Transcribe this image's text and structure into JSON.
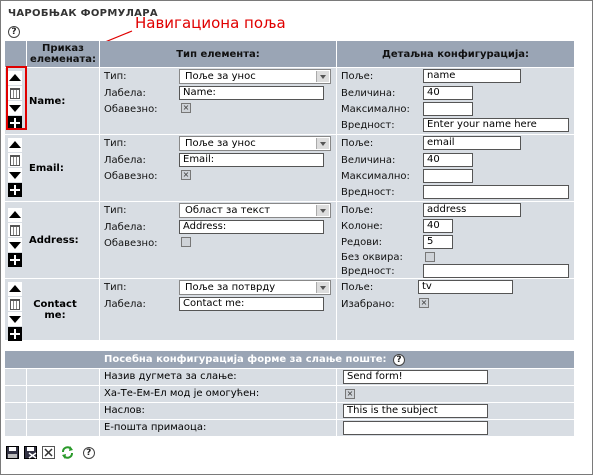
{
  "wizard_title": "ЧАРОБЊАК ФОРМУЛАРА",
  "annotation": "Навигациона поља",
  "headers": {
    "preview": "Приказ елемената:",
    "type": "Тип елемента:",
    "detail": "Детаљна конфигурација:"
  },
  "labels": {
    "type": "Тип:",
    "label": "Лабела:",
    "required": "Обавезно:",
    "field": "Поље:",
    "size": "Величина:",
    "max": "Максимално:",
    "value": "Вредност:",
    "columns": "Колоне:",
    "rows": "Редови:",
    "no_frame": "Без оквира:",
    "selected": "Изабрано:"
  },
  "elements": [
    {
      "name": "Name:",
      "type": "Поље за унос",
      "label": "Name:",
      "field": "name",
      "size": "40",
      "max": "",
      "value": "Enter your name here"
    },
    {
      "name": "Email:",
      "type": "Поље за унос",
      "label": "Email:",
      "field": "email",
      "size": "40",
      "max": "",
      "value": ""
    },
    {
      "name": "Address:",
      "type": "Област за текст",
      "label": "Address:",
      "field": "address",
      "columns": "40",
      "rows": "5",
      "value": ""
    },
    {
      "name": "Contact me:",
      "type": "Поље за потврду",
      "label": "Contact me:",
      "field": "tv"
    }
  ],
  "email_config": {
    "title": "Посебна конфигурација форме за слање поште:",
    "rows": [
      {
        "label": "Назив дугмета за слање:",
        "value": "Send form!"
      },
      {
        "label": "Ха-Те-Ем-Ел мод је омогућен:",
        "value": ""
      },
      {
        "label": "Наслов:",
        "value": "This is the subject"
      },
      {
        "label": "Е-пошта примаоца:",
        "value": ""
      }
    ]
  },
  "icons": [
    "help-icon",
    "move-up-icon",
    "delete-icon",
    "move-down-icon",
    "add-icon",
    "save-icon",
    "save-close-icon",
    "close-icon",
    "refresh-icon"
  ]
}
